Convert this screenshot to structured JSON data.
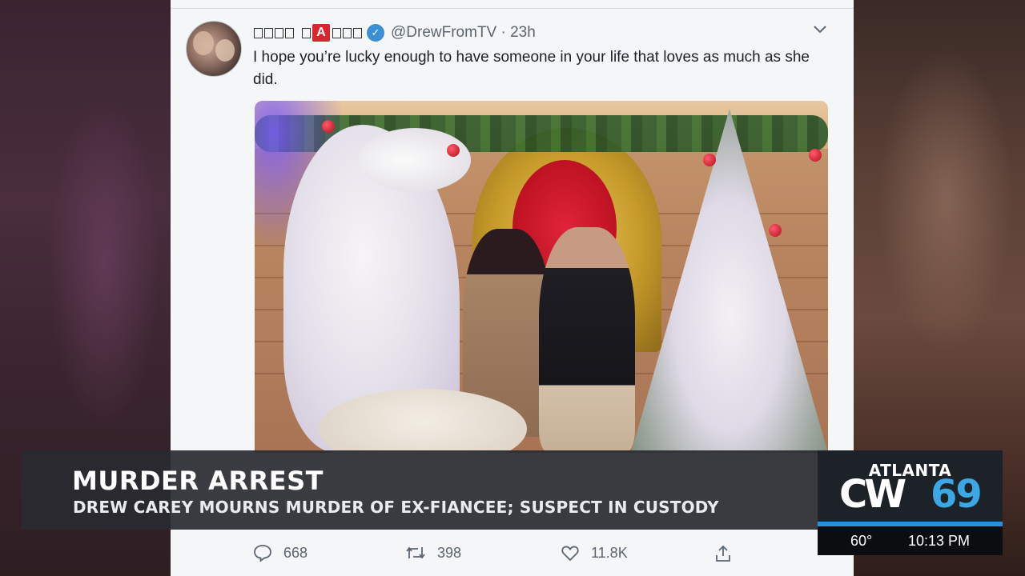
{
  "tweet": {
    "name_display_a": "A",
    "handle_time": "@DrewFromTV · 23h",
    "text": "I hope you’re lucky enough to have someone in your life that loves as much as she did.",
    "actions": {
      "replies": "668",
      "retweets": "398",
      "likes": "11.8K"
    }
  },
  "lower_third": {
    "headline": "MURDER ARREST",
    "subhead": "DREW CAREY MOURNS MURDER OF EX-FIANCEE; SUSPECT IN CUSTODY"
  },
  "station": {
    "city": "ATLANTA",
    "network": "CW",
    "channel": "69",
    "temperature": "60°",
    "time": "10:13 PM"
  },
  "colors": {
    "network_blue": "#3da6e4",
    "accent_bar": "#2a8fd8",
    "verified_blue": "#3b8fd6",
    "name_badge_red": "#d8262e"
  }
}
